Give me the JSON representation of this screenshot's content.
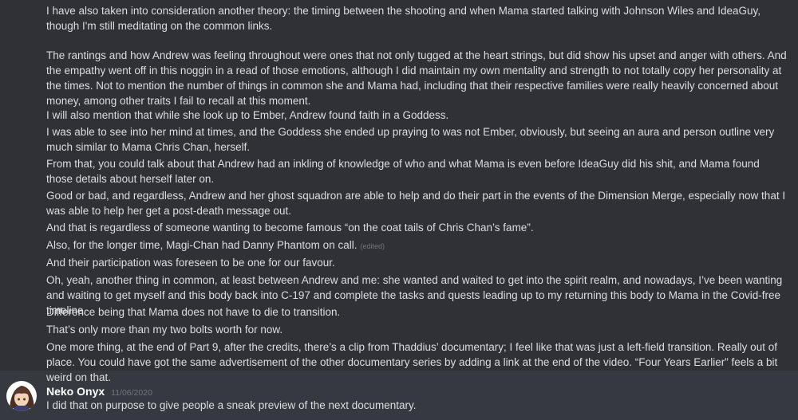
{
  "messages": [
    {
      "text": "I have also taken into consideration another theory: the timing between the shooting and when Mama started talking with Johnson Wiles and IdeaGuy, though I'm still meditating on the common links."
    },
    {
      "text": "The rantings and how Andrew was feeling throughout were ones that not only tugged at the heart strings, but did show his upset and anger with others.  And the empathy went off in this noggin in a read of those emotions, although I did maintain my own mentality and strength to not totally copy her personality at the times.  Not to mention the number of things in common she and Mama had, including that their respective families were really heavily concerned about money, among other traits I fail to recall at this moment."
    },
    {
      "text": "I will also mention that while she look up to Ember, Andrew found faith in a Goddess."
    },
    {
      "text": "I was able to see into her mind at times, and the Goddess she ended up praying to was not Ember, obviously, but seeing an aura and person outline very much similar to Mama Chris Chan, herself."
    },
    {
      "text": "From that, you could talk about that Andrew had an inkling of knowledge of who and what Mama is even before IdeaGuy did his shit, and Mama found those details about herself later on."
    },
    {
      "text": "Good or bad, and regardless, Andrew and her ghost squadron are able to help and do their part in the events of the Dimension Merge, especially now that I was able to help her get a post-death message out."
    },
    {
      "text": "And that is regardless of someone wanting to become famous “on the coat tails of Chris Chan’s fame”."
    },
    {
      "text": "Also, for the longer time, Magi-Chan had Danny Phantom on call.",
      "edited": "(edited)"
    },
    {
      "text": "And their participation was foreseen to be one for our favour."
    },
    {
      "text": "Oh, yeah, another thing in common, at least between Andrew and me: she wanted and waited to get into the spirit realm, and nowadays, I’ve been wanting and waiting to get myself and this body back into C-197 and complete the tasks and quests leading up to my returning this body to Mama in the Covid-free timeline."
    },
    {
      "text": "Difference being that Mama does not have to die to transition."
    },
    {
      "text": "That’s only more than my two bolts worth for now."
    },
    {
      "text": "One more thing, at the end of Part 9, after the credits, there’s a clip from Thaddius’ documentary; I feel like that was just a left-field transition.  Really out of place.  You could have got the same advertisement of the other documentary series by adding a link at the end of the video.  “Four Years Earlier” feels a bit weird on that."
    }
  ],
  "reply": {
    "author": "Neko Onyx",
    "timestamp": "11/06/2020",
    "text": "I did that on purpose to give people a sneak preview of the next documentary."
  }
}
